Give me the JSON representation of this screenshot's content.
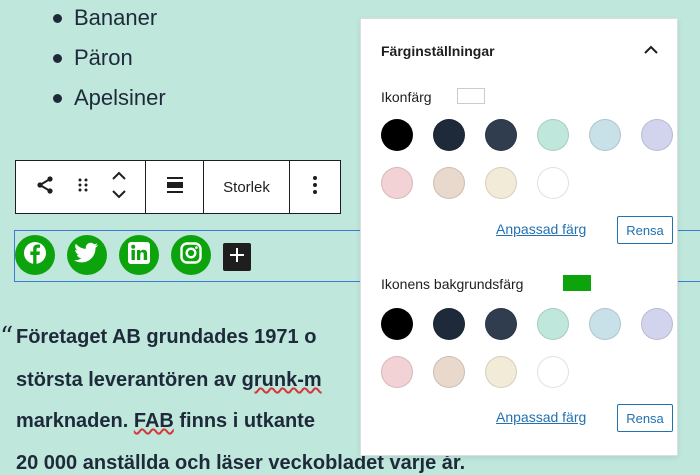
{
  "list": {
    "items": [
      "Bananer",
      "Päron",
      "Apelsiner"
    ]
  },
  "toolbar": {
    "size_label": "Storlek"
  },
  "social": {
    "icons": [
      "facebook-icon",
      "twitter-icon",
      "linkedin-icon",
      "instagram-icon"
    ],
    "icon_color": "#0da30d"
  },
  "quote": {
    "mark": "“",
    "lines": [
      "Företaget AB grundades 1971 o",
      "största leverantören av grunk-m",
      "marknaden. FAB finns i utkante",
      "20 000 anställda och läser veckobladet varje år."
    ]
  },
  "panel": {
    "title": "Färginställningar",
    "icon_color": {
      "label": "Ikonfärg",
      "current": "#ffffff",
      "custom_label": "Anpassad färg",
      "clear_label": "Rensa"
    },
    "bg_color": {
      "label": "Ikonens bakgrundsfärg",
      "current": "#0da30d",
      "custom_label": "Anpassad färg",
      "clear_label": "Rensa"
    },
    "palette": [
      "#000000",
      "#1e2a3a",
      "#2f3d4e",
      "#bfe7dc",
      "#c8e0e8",
      "#d2d4ee",
      "#f2d2d4",
      "#e9d8cc",
      "#f2ebd8",
      "#ffffff"
    ]
  }
}
